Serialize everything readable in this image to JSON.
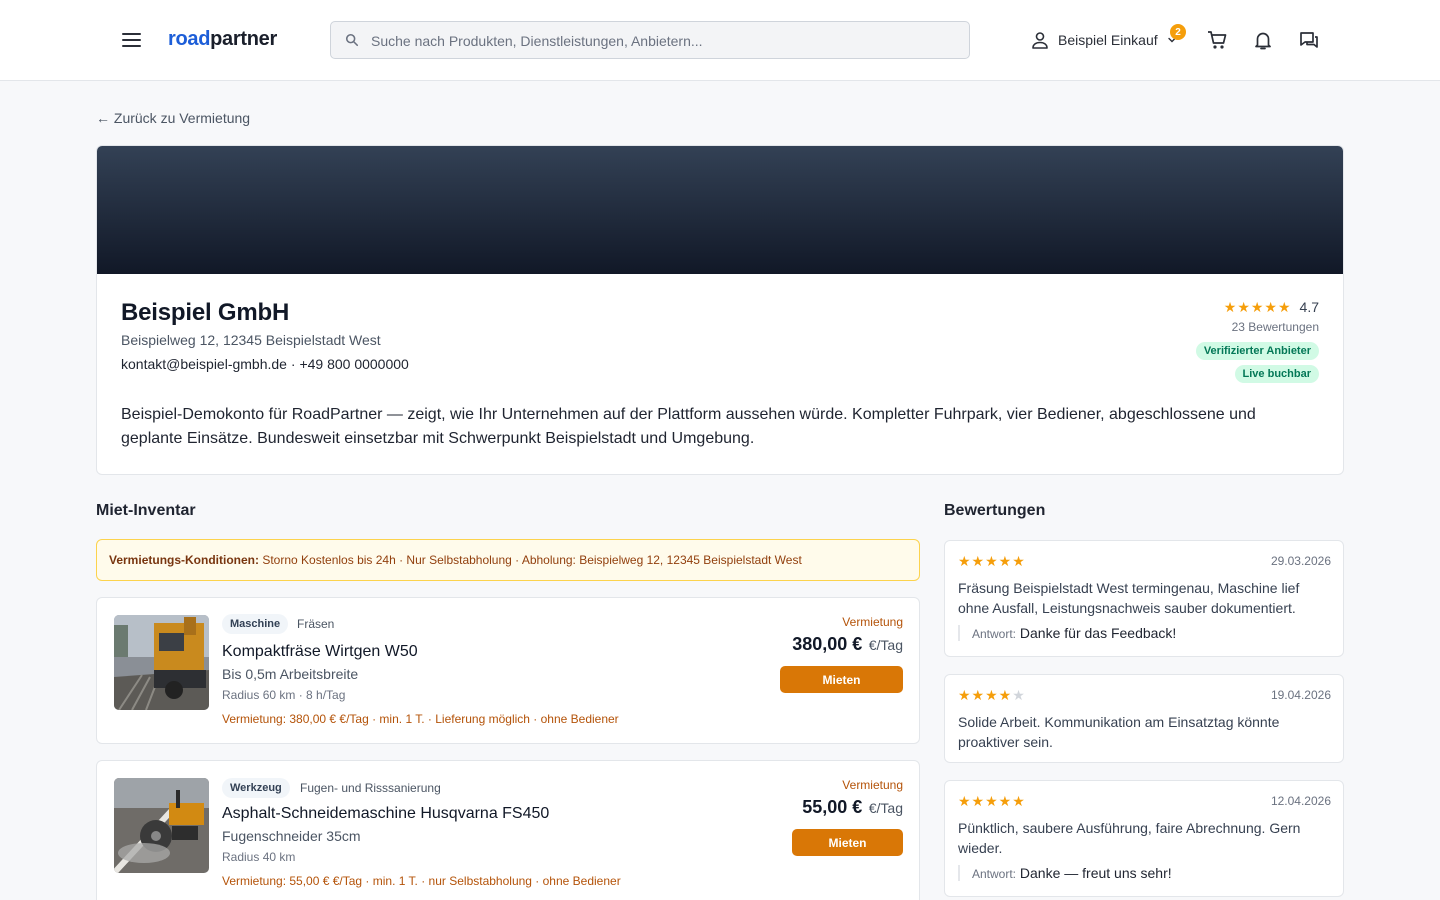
{
  "header": {
    "logo_part1": "road",
    "logo_part2": "partner",
    "search_placeholder": "Suche nach Produkten, Dienstleistungen, Anbietern...",
    "user_name": "Beispiel Einkauf",
    "notification_badge": "2",
    "icons": [
      "menu-icon",
      "search-icon",
      "user-icon",
      "chevron-down-icon",
      "cart-icon",
      "bell-icon",
      "chat-icon"
    ]
  },
  "back_link": "← Zurück zu Vermietung",
  "profile": {
    "name": "Beispiel GmbH",
    "address": "Beispielweg 12, 12345 Beispielstadt West",
    "email": "kontakt@beispiel-gmbh.de",
    "separator": " · ",
    "phone": "+49 800 0000000",
    "rating_stars": "★★★★★",
    "rating": "4.7",
    "rating_count": "23 Bewertungen",
    "badge_verified": "Verifizierter Anbieter",
    "badge_live": "Live buchbar",
    "description": "Beispiel-Demokonto für RoadPartner — zeigt, wie Ihr Unternehmen auf der Plattform aussehen würde. Kompletter Fuhrpark, vier Bediener, abgeschlossene und geplante Einsätze. Bundesweit einsetzbar mit Schwerpunkt Beispielstadt und Umgebung."
  },
  "inventory": {
    "title": "Miet-Inventar",
    "conditions_label": "Vermietungs-Konditionen:",
    "conditions_text": "Storno Kostenlos bis 24h · Nur Selbstabholung · Abholung: Beispielweg 12, 12345 Beispielstadt West",
    "items": [
      {
        "tag": "Maschine",
        "category": "Fräsen",
        "title": "Kompaktfräse Wirtgen W50",
        "subtitle": "Bis 0,5m Arbeitsbreite",
        "meta": "Radius 60 km · 8 h/Tag",
        "terms": "Vermietung: 380,00 € €/Tag · min. 1 T. · Lieferung möglich · ohne Bediener",
        "type": "Vermietung",
        "price": "380,00 €",
        "unit": "€/Tag",
        "button": "Mieten"
      },
      {
        "tag": "Werkzeug",
        "category": "Fugen- und Risssanierung",
        "title": "Asphalt-Schneidemaschine Husqvarna FS450",
        "subtitle": "Fugenschneider 35cm",
        "meta": "Radius 40 km",
        "terms": "Vermietung: 55,00 € €/Tag · min. 1 T. · nur Selbstabholung · ohne Bediener",
        "type": "Vermietung",
        "price": "55,00 €",
        "unit": "€/Tag",
        "button": "Mieten"
      }
    ]
  },
  "reviews": {
    "title": "Bewertungen",
    "reply_label": "Antwort:",
    "items": [
      {
        "stars_filled": "★★★★★",
        "stars_empty": "",
        "rating": 5,
        "date": "29.03.2026",
        "text": "Fräsung Beispielstadt West termingenau, Maschine lief ohne Ausfall, Leistungsnachweis sauber dokumentiert.",
        "reply": "Danke für das Feedback!"
      },
      {
        "stars_filled": "★★★★",
        "stars_empty": "★",
        "rating": 4,
        "date": "19.04.2026",
        "text": "Solide Arbeit. Kommunikation am Einsatztag könnte proaktiver sein.",
        "reply": ""
      },
      {
        "stars_filled": "★★★★★",
        "stars_empty": "",
        "rating": 5,
        "date": "12.04.2026",
        "text": "Pünktlich, saubere Ausführung, faire Abrechnung. Gern wieder.",
        "reply": "Danke — freut uns sehr!"
      }
    ]
  },
  "colors": {
    "brand_blue": "#1d5ed8",
    "accent_orange": "#d97706",
    "star": "#f59e0b",
    "verified_green": "#047857"
  }
}
